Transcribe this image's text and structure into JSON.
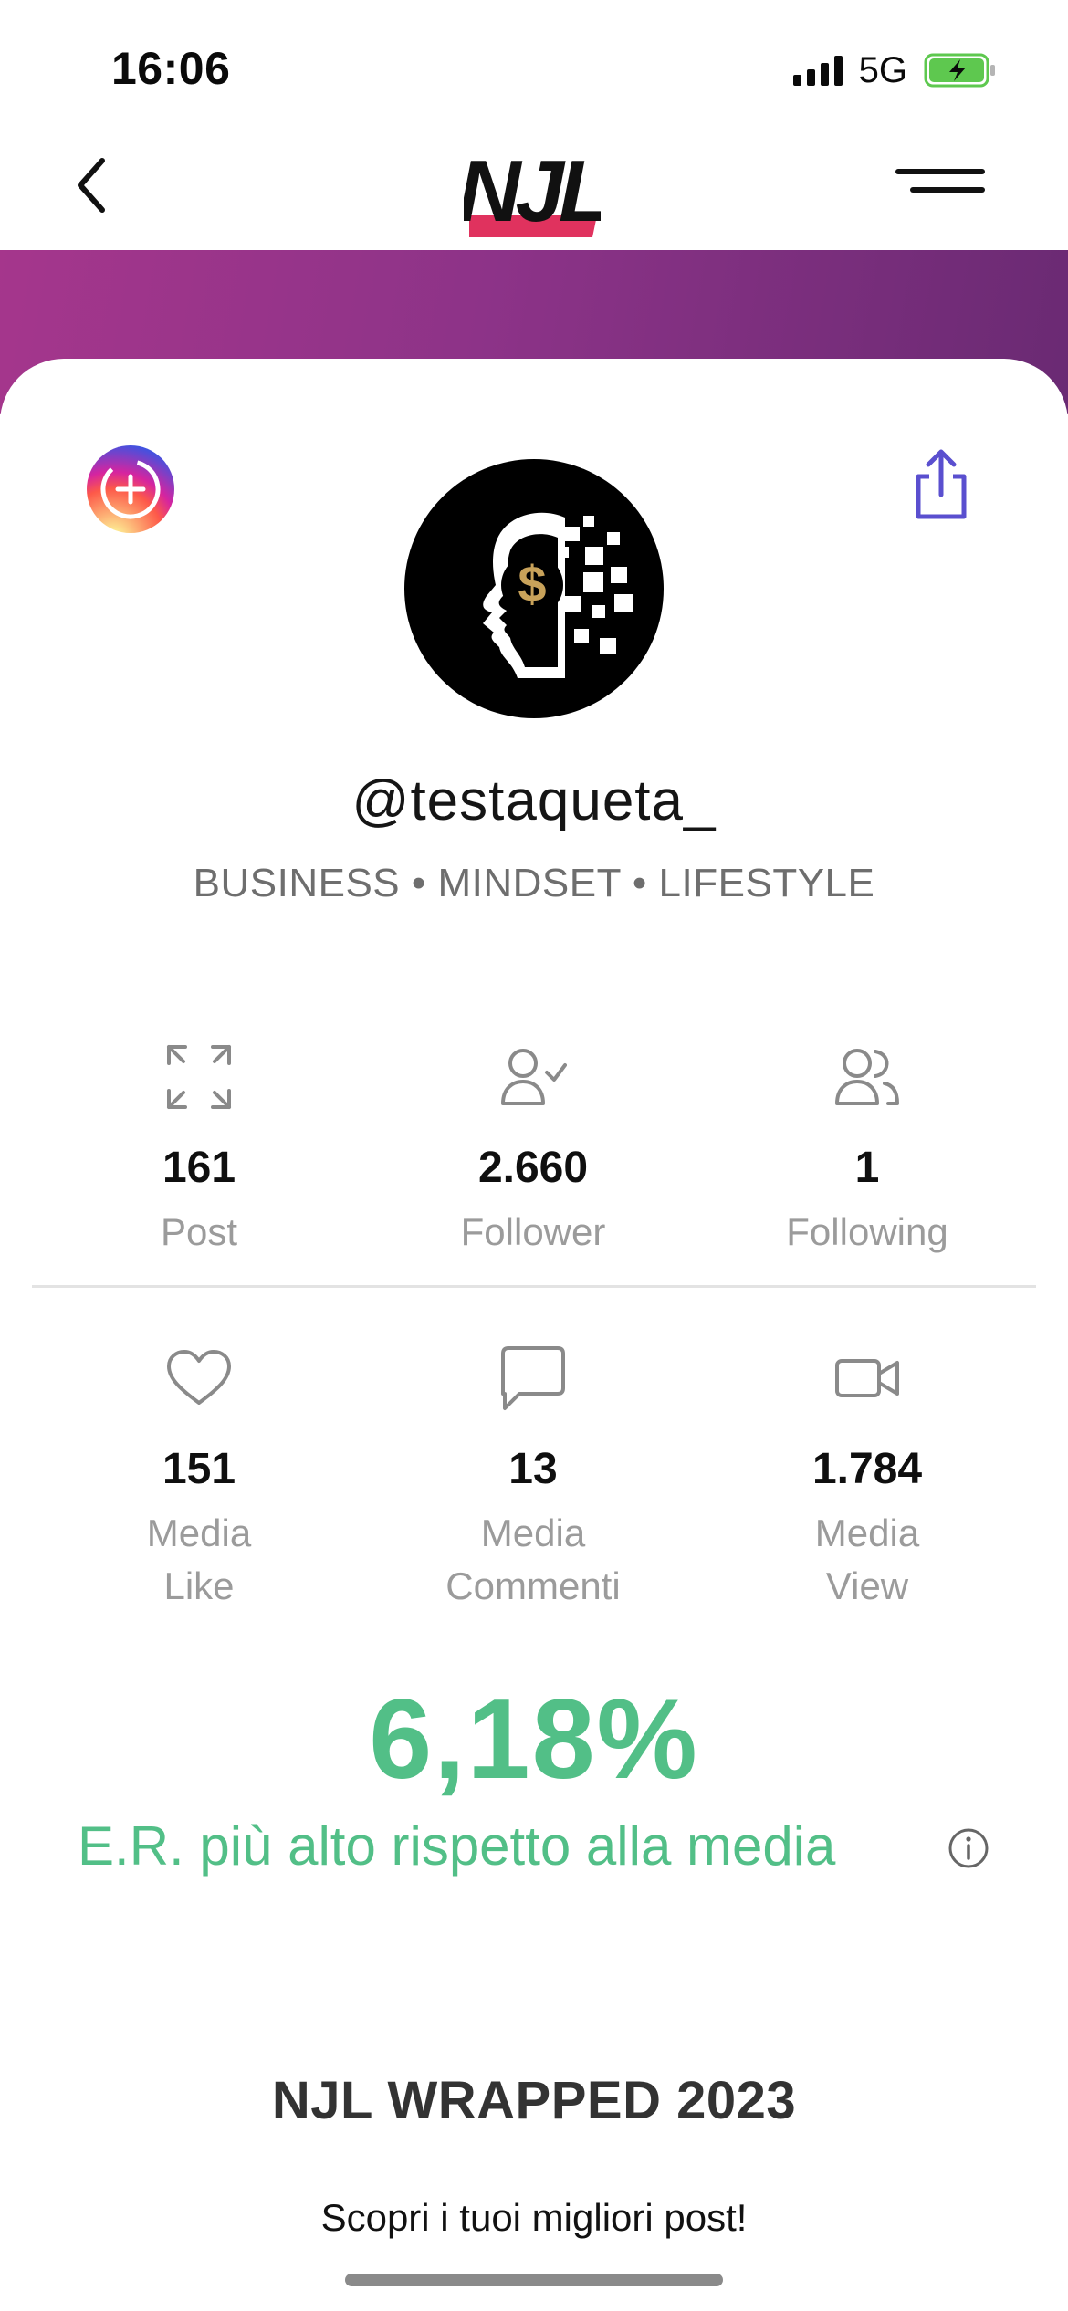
{
  "status_bar": {
    "time": "16:06",
    "network": "5G",
    "battery_color": "#5ec84f"
  },
  "nav": {
    "back_icon": "chevron-left-icon",
    "logo_text": "NJL",
    "logo_accent": "#e0325e",
    "menu_icon": "hamburger-menu-icon"
  },
  "header": {
    "gradient_colors": [
      "#a5368c",
      "#8d3388",
      "#6a2a73"
    ]
  },
  "profile": {
    "add_story_icon": "instagram-add-icon",
    "share_icon": "share-icon",
    "avatar_icon": "head-dollar-avatar",
    "username": "@testaqueta_",
    "bio": "BUSINESS • MINDSET • LIFESTYLE"
  },
  "stats_primary": [
    {
      "icon": "expand-icon",
      "value": "161",
      "label": "Post"
    },
    {
      "icon": "user-check-icon",
      "value": "2.660",
      "label": "Follower"
    },
    {
      "icon": "users-icon",
      "value": "1",
      "label": "Following"
    }
  ],
  "stats_media": [
    {
      "icon": "heart-icon",
      "value": "151",
      "label_line1": "Media",
      "label_line2": "Like"
    },
    {
      "icon": "comment-icon",
      "value": "13",
      "label_line1": "Media",
      "label_line2": "Commenti"
    },
    {
      "icon": "video-icon",
      "value": "1.784",
      "label_line1": "Media",
      "label_line2": "View"
    }
  ],
  "engagement": {
    "rate": "6,18%",
    "description": "E.R. più alto rispetto alla media",
    "info_icon": "info-icon",
    "color": "#52bf87"
  },
  "wrapped": {
    "title": "NJL WRAPPED 2023",
    "subtitle": "Scopri i tuoi migliori post!"
  }
}
